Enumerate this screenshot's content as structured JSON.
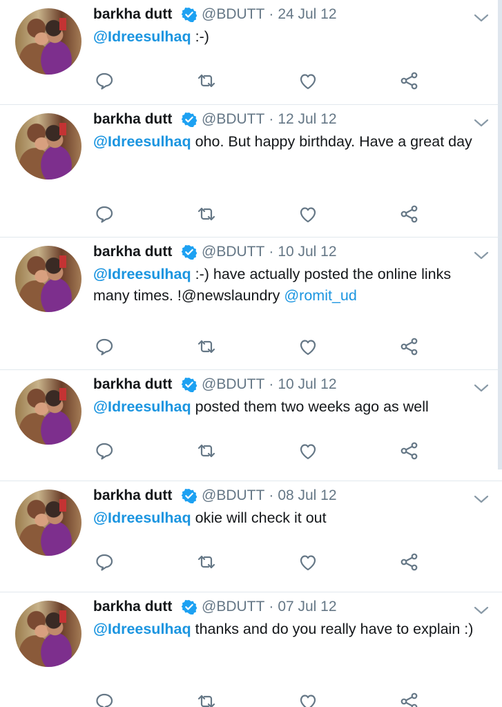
{
  "account": {
    "name": "barkha dutt",
    "handle": "@BDUTT",
    "verified_icon": "verified-badge-icon",
    "avatar_alt": "profile photo"
  },
  "colors": {
    "link": "#1b95e0",
    "meta": "#657786",
    "text": "#14171a",
    "divider": "#e1e8ed"
  },
  "tweets": [
    {
      "date": "24 Jul 12",
      "reply_to": "@Idreesulhaq",
      "text": " :-)",
      "extra_mention": ""
    },
    {
      "date": "12 Jul 12",
      "reply_to": "@Idreesulhaq",
      "text": " oho. But happy birthday. Have a great day",
      "extra_mention": ""
    },
    {
      "date": "10 Jul 12",
      "reply_to": "@Idreesulhaq",
      "text": " :-) have actually posted the online links many times. !@newslaundry ",
      "extra_mention": "@romit_ud"
    },
    {
      "date": "10 Jul 12",
      "reply_to": "@Idreesulhaq",
      "text": " posted them two weeks ago as well",
      "extra_mention": ""
    },
    {
      "date": "08 Jul 12",
      "reply_to": "@Idreesulhaq",
      "text": " okie will check it out",
      "extra_mention": ""
    },
    {
      "date": "07 Jul 12",
      "reply_to": "@Idreesulhaq",
      "text": " thanks and do you really have to explain :)",
      "extra_mention": ""
    }
  ],
  "actions": [
    "reply-icon",
    "retweet-icon",
    "like-icon",
    "share-icon"
  ],
  "separator": "·"
}
